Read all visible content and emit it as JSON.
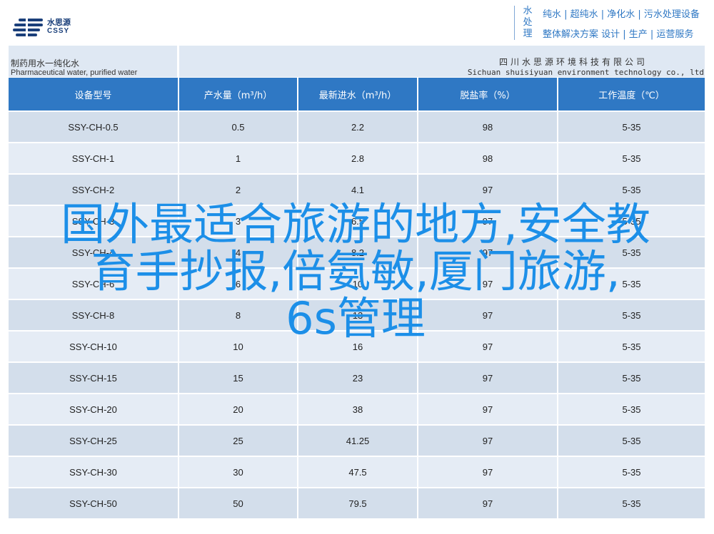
{
  "header": {
    "logo_cn": "水思源",
    "logo_en": "CSSY",
    "brand_vertical": "水处理",
    "slogan_line1": "纯水 | 超纯水 | 净化水 | 污水处理设备",
    "slogan_line2": "整体解决方案 设计 | 生产 | 运营服务"
  },
  "info_bar": {
    "product_cn": "制药用水一纯化水",
    "product_en": "Pharmaceutical water, purified water",
    "company_cn": "四川水思源环境科技有限公司",
    "company_en": "Sichuan shuisiyuan environment technology co., ltd"
  },
  "table": {
    "columns": [
      "设备型号",
      "产水量（m³/h）",
      "最新进水（m³/h）",
      "脱盐率（%）",
      "工作温度（℃）"
    ],
    "rows": [
      [
        "SSY-CH-0.5",
        "0.5",
        "2.2",
        "98",
        "5-35"
      ],
      [
        "SSY-CH-1",
        "1",
        "2.8",
        "98",
        "5-35"
      ],
      [
        "SSY-CH-2",
        "2",
        "4.1",
        "97",
        "5-35"
      ],
      [
        "SSY-CH-3",
        "3",
        "6.5",
        "97",
        "5-35"
      ],
      [
        "SSY-CH-4",
        "4",
        "8.2",
        "97",
        "5-35"
      ],
      [
        "SSY-CH-6",
        "6",
        "10",
        "97",
        "5-35"
      ],
      [
        "SSY-CH-8",
        "8",
        "13",
        "97",
        "5-35"
      ],
      [
        "SSY-CH-10",
        "10",
        "16",
        "97",
        "5-35"
      ],
      [
        "SSY-CH-15",
        "15",
        "23",
        "97",
        "5-35"
      ],
      [
        "SSY-CH-20",
        "20",
        "38",
        "97",
        "5-35"
      ],
      [
        "SSY-CH-25",
        "25",
        "41.25",
        "97",
        "5-35"
      ],
      [
        "SSY-CH-30",
        "30",
        "47.5",
        "97",
        "5-35"
      ],
      [
        "SSY-CH-50",
        "50",
        "79.5",
        "97",
        "5-35"
      ]
    ]
  },
  "overlay": {
    "line1": "国外最适合旅游的地方,安全教",
    "line2": "育手抄报,倍氨敏,厦门旅游,",
    "line3": "6s管理"
  },
  "colors": {
    "header_blue": "#2f78c4",
    "row_dark": "#d3deeb",
    "row_light": "#e5ecf5",
    "overlay_text": "#1c8fe8"
  }
}
